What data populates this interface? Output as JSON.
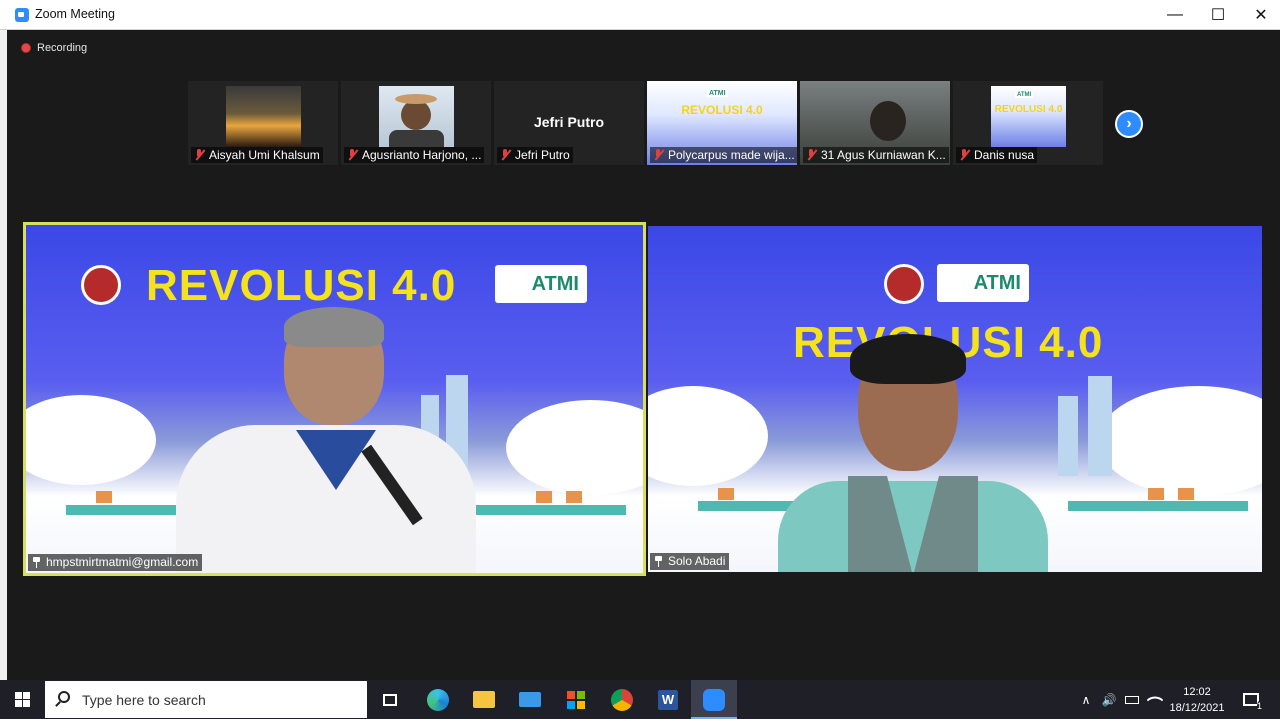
{
  "window": {
    "title": "Zoom Meeting",
    "minimize_label": "—",
    "maximize_label": "☐",
    "close_label": "✕"
  },
  "meeting": {
    "recording_label": "Recording",
    "next_page_label": "›"
  },
  "thumbnails": [
    {
      "name": "Aisyah Umi Khalsum",
      "muted": true,
      "kind": "video"
    },
    {
      "name": "Agusrianto Harjono, ...",
      "muted": true,
      "kind": "video"
    },
    {
      "name": "Jefri Putro",
      "muted": true,
      "kind": "name-only",
      "display_name": "Jefri Putro"
    },
    {
      "name": "Polycarpus made wija...",
      "muted": true,
      "kind": "video"
    },
    {
      "name": "31 Agus Kurniawan K...",
      "muted": true,
      "kind": "video"
    },
    {
      "name": "Danis nusa",
      "muted": true,
      "kind": "video"
    }
  ],
  "thumb_banner": {
    "logo_text": "ATMI",
    "title": "REVOLUSI 4.0"
  },
  "main_videos": [
    {
      "name": "hmpstmirtmatmi@gmail.com",
      "active_speaker": true,
      "banner_title": "REVOLUSI 4.0",
      "banner_logo": "ATMI"
    },
    {
      "name": "Solo Abadi",
      "active_speaker": false,
      "banner_title": "REVOLUSI 4.0",
      "banner_logo": "ATMI"
    }
  ],
  "taskbar": {
    "search_placeholder": "Type here to search",
    "time": "12:02",
    "date": "18/12/2021",
    "notification_count": "1",
    "apps": [
      "task-view",
      "edge",
      "file-explorer",
      "mail",
      "store",
      "chrome",
      "word",
      "zoom"
    ],
    "tray_chevron": "∧",
    "tray_volume": "🔊"
  },
  "colors": {
    "zoom_blue": "#2d8cff",
    "active_speaker_border": "#d6e05a",
    "banner_yellow": "#f4e21a",
    "banner_blue": "#3d54e8"
  }
}
